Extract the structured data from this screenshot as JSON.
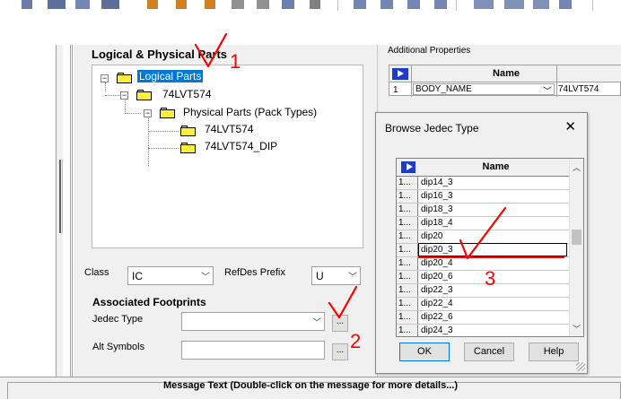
{
  "tree": {
    "group_title": "Logical & Physical Parts",
    "nodes": [
      {
        "label": "Logical Parts",
        "selected": true
      },
      {
        "label": "74LVT574"
      },
      {
        "label": "Physical Parts (Pack Types)"
      },
      {
        "label": "74LVT574"
      },
      {
        "label": "74LVT574_DIP"
      }
    ]
  },
  "form": {
    "class_label": "Class",
    "class_value": "IC",
    "refdes_label": "RefDes Prefix",
    "refdes_value": "U",
    "associated_title": "Associated Footprints",
    "jedec_label": "Jedec Type",
    "jedec_value": "",
    "browse_label": "...",
    "alt_symbols_label": "Alt Symbols",
    "alt_symbols_value": ""
  },
  "properties": {
    "title": "Additional Properties",
    "header_name": "Name",
    "rows": [
      {
        "num": "1",
        "name": "BODY_NAME",
        "value": "74LVT574"
      }
    ]
  },
  "dialog": {
    "title": "Browse Jedec Type",
    "close": "✕",
    "header_name": "Name",
    "row_num": "1...",
    "rows": [
      "dip14_3",
      "dip16_3",
      "dip18_3",
      "dip18_4",
      "dip20",
      "dip20_3",
      "dip20_4",
      "dip20_6",
      "dip22_3",
      "dip22_4",
      "dip22_6",
      "dip24_3"
    ],
    "current_row": "dip20_3",
    "buttons": {
      "ok": "OK",
      "cancel": "Cancel",
      "help": "Help"
    }
  },
  "annotations": [
    "1",
    "2",
    "3"
  ],
  "status_text": "Message Text (Double-click on the message for more details...)",
  "colors": {
    "selection": "#0078d7",
    "marker": "#1e3cc8",
    "annotation": "#ff0000",
    "folder": "#ffee3a"
  }
}
